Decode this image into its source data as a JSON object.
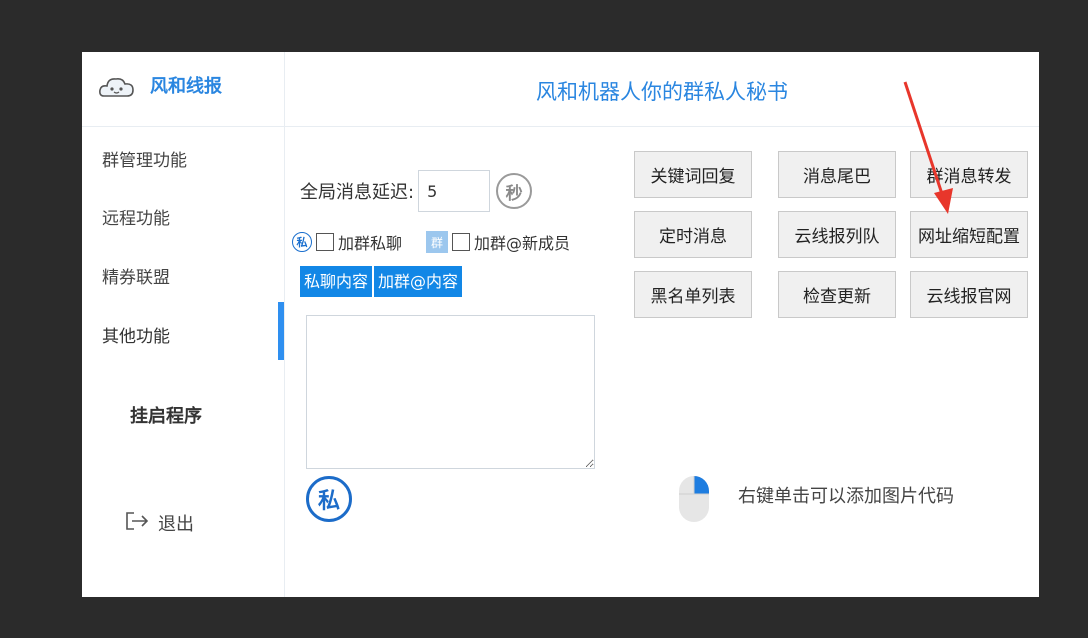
{
  "brand": {
    "name": "风和线报",
    "logo_icon": "cloud-logo-icon"
  },
  "header": {
    "title": "风和机器人你的群私人秘书"
  },
  "sidebar": {
    "items": [
      {
        "label": "群管理功能"
      },
      {
        "label": "远程功能"
      },
      {
        "label": "精券联盟"
      },
      {
        "label": "其他功能",
        "active": true
      }
    ],
    "launch_label": "挂启程序",
    "logout_label": "退出"
  },
  "delay": {
    "label": "全局消息延迟:",
    "value": "5",
    "unit": "秒"
  },
  "options": {
    "private_badge": "私",
    "group_badge": "群",
    "join_private_label": "加群私聊",
    "join_mention_label": "加群@新成员"
  },
  "tabs": [
    {
      "label": "私聊内容"
    },
    {
      "label": "加群@内容"
    }
  ],
  "private_big_badge": "私",
  "buttons": {
    "keyword_reply": "关键词回复",
    "msg_tail": "消息尾巴",
    "group_forward": "群消息转发",
    "timed_msg": "定时消息",
    "cloud_queue": "云线报列队",
    "url_shorten": "网址缩短配置",
    "blacklist": "黑名单列表",
    "check_update": "检查更新",
    "cloud_site": "云线报官网"
  },
  "hint": "右键单击可以添加图片代码",
  "colors": {
    "accent": "#2a86e0",
    "tab_bg": "#1287e6",
    "arrow": "#e8362b"
  }
}
